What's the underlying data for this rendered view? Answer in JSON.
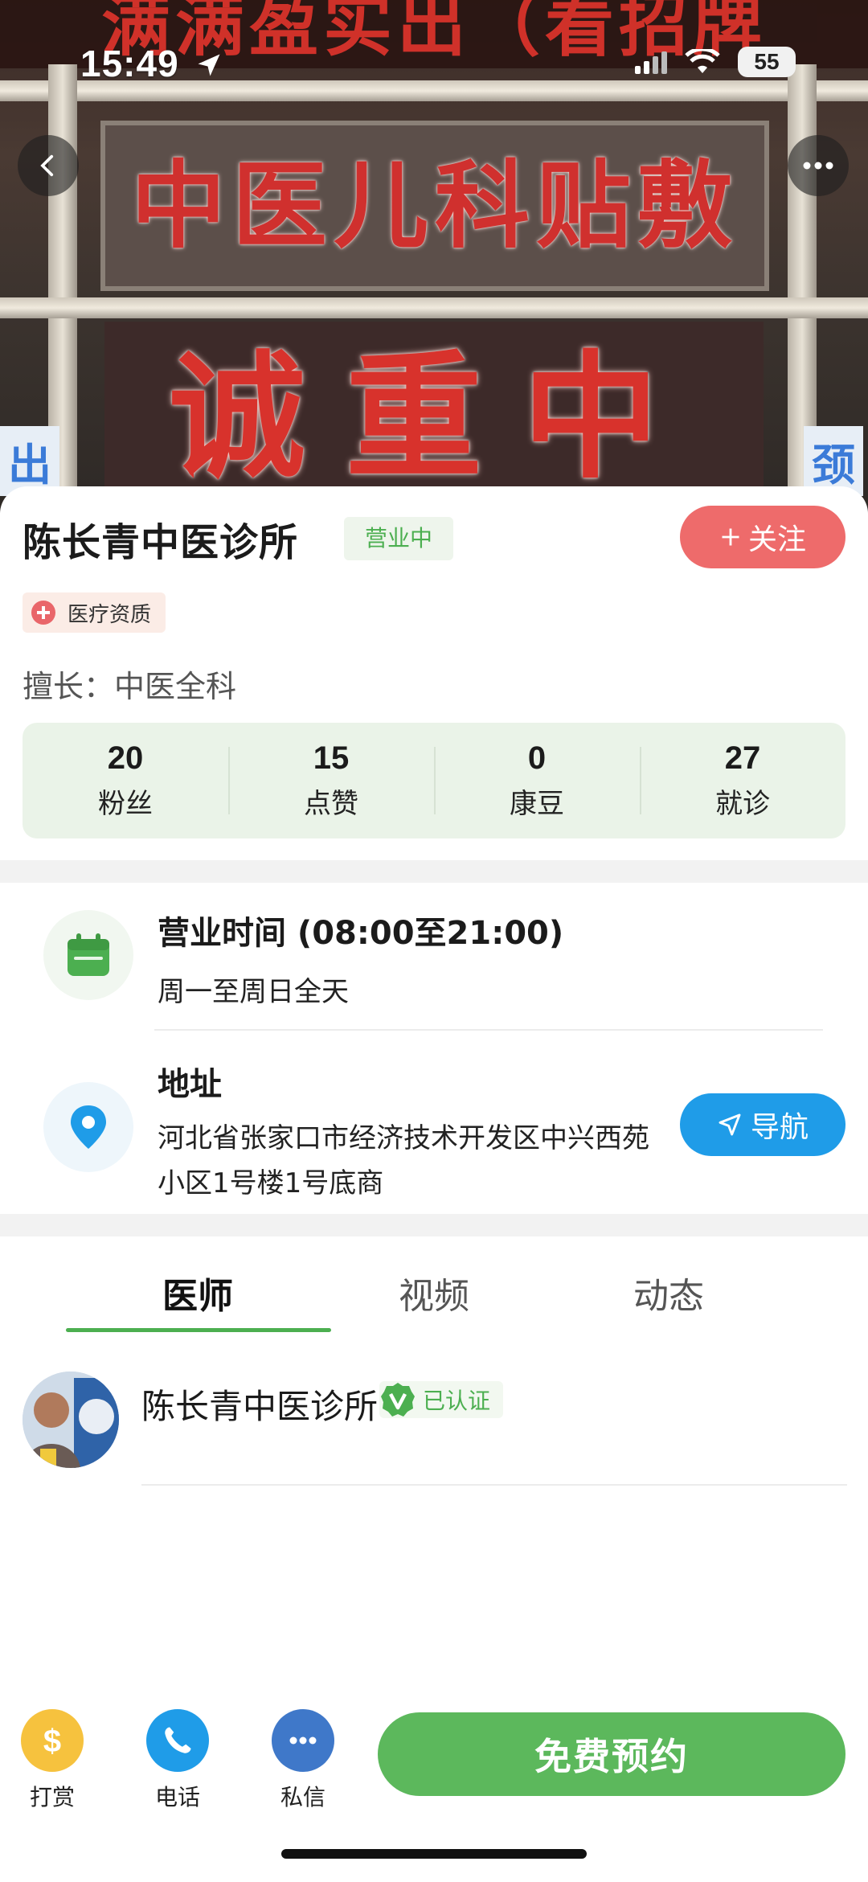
{
  "status": {
    "time": "15:49",
    "battery": "55"
  },
  "hero": {
    "banner_text": "满满盈实出（看招牌",
    "sign1": "中医儿科贴敷",
    "sign2": "诚重中医",
    "side_left": "出",
    "side_right": "颈"
  },
  "shop": {
    "name": "陈长青中医诊所",
    "open_status": "营业中",
    "follow_label": "关注",
    "qualification": "医疗资质",
    "specialty": "擅长：中医全科"
  },
  "stats": [
    {
      "value": "20",
      "label": "粉丝"
    },
    {
      "value": "15",
      "label": "点赞"
    },
    {
      "value": "0",
      "label": "康豆"
    },
    {
      "value": "27",
      "label": "就诊"
    }
  ],
  "hours": {
    "title": "营业时间 (08:00至21:00)",
    "detail": "周一至周日全天"
  },
  "address": {
    "title": "地址",
    "text": "河北省张家口市经济技术开发区中兴西苑小区1号楼1号底商",
    "nav_label": "导航"
  },
  "tabs": [
    {
      "label": "医师"
    },
    {
      "label": "视频"
    },
    {
      "label": "动态"
    }
  ],
  "doctor": {
    "name": "陈长青中医诊所",
    "verified_label": "已认证"
  },
  "bottom": {
    "actions": [
      {
        "label": "打赏",
        "icon": "dollar-icon",
        "color": "#f6c23e"
      },
      {
        "label": "电话",
        "icon": "phone-icon",
        "color": "#1f9ce8"
      },
      {
        "label": "私信",
        "icon": "chat-icon",
        "color": "#3f78c9"
      }
    ],
    "book_label": "免费预约"
  },
  "colors": {
    "accent_green": "#4caf50",
    "follow_red": "#ee6b6b",
    "nav_blue": "#1f9ce8",
    "book_green": "#5cb85c"
  }
}
